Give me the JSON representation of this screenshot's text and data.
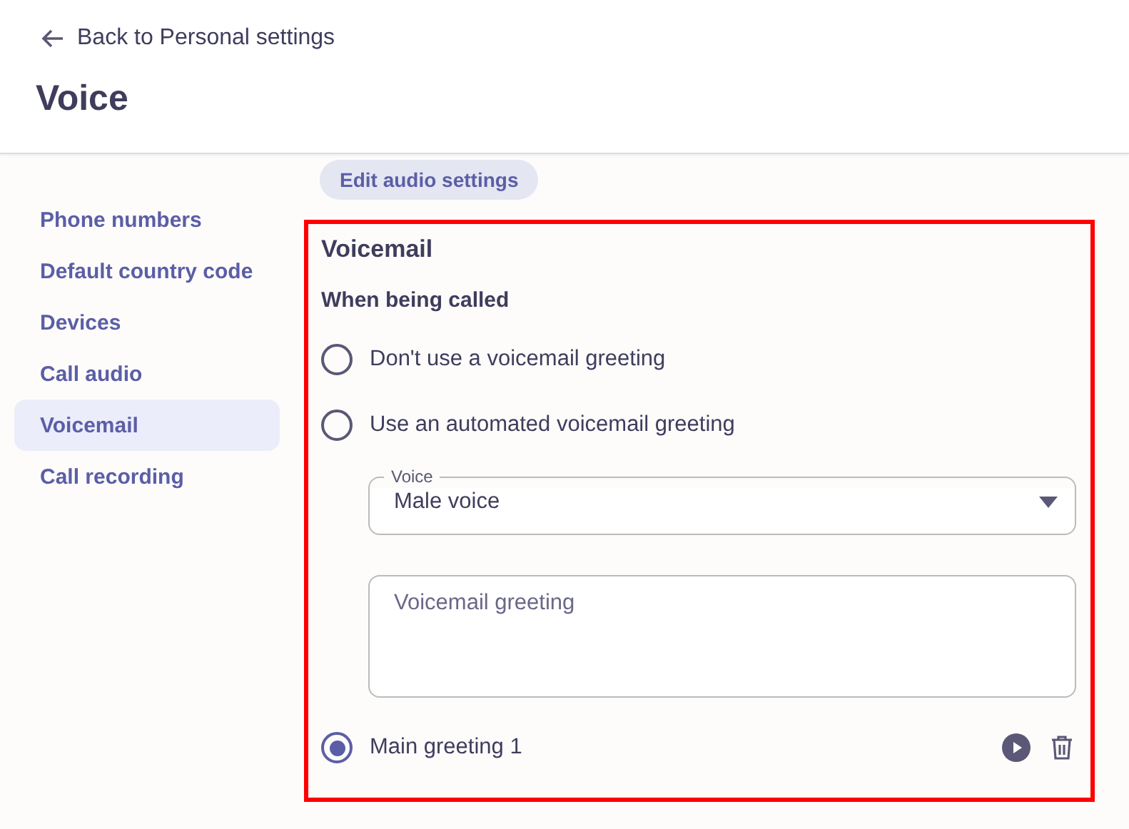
{
  "header": {
    "back_link": "Back to Personal settings",
    "title": "Voice"
  },
  "sidebar": {
    "items": [
      {
        "label": "Phone numbers",
        "selected": false
      },
      {
        "label": "Default country code",
        "selected": false
      },
      {
        "label": "Devices",
        "selected": false
      },
      {
        "label": "Call audio",
        "selected": false
      },
      {
        "label": "Voicemail",
        "selected": true
      },
      {
        "label": "Call recording",
        "selected": false
      }
    ]
  },
  "edit_audio_button": "Edit audio settings",
  "voicemail": {
    "title": "Voicemail",
    "subtitle": "When being called",
    "options": [
      {
        "label": "Don't use a voicemail greeting",
        "selected": false
      },
      {
        "label": "Use an automated voicemail greeting",
        "selected": false
      }
    ],
    "voice_select": {
      "label": "Voice",
      "value": "Male voice"
    },
    "greeting_field": {
      "placeholder": "Voicemail greeting"
    },
    "greetings": [
      {
        "label": "Main greeting 1",
        "selected": true
      }
    ]
  }
}
